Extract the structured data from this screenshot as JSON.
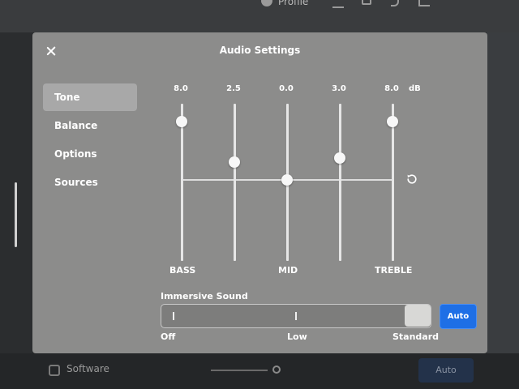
{
  "background": {
    "top_bar": {
      "profile_label": "Profile"
    },
    "bottom_bar": {
      "software_label": "Software",
      "auto_label": "Auto"
    }
  },
  "modal": {
    "title": "Audio Settings",
    "close_icon": "close-icon"
  },
  "sidebar": {
    "items": [
      {
        "label": "Tone",
        "active": true
      },
      {
        "label": "Balance",
        "active": false
      },
      {
        "label": "Options",
        "active": false
      },
      {
        "label": "Sources",
        "active": false
      }
    ]
  },
  "equalizer": {
    "unit": "dB",
    "min": -10,
    "max": 10,
    "bands": [
      {
        "value_label": "8.0",
        "value": 8.0
      },
      {
        "value_label": "2.5",
        "value": 2.5
      },
      {
        "value_label": "0.0",
        "value": 0.0
      },
      {
        "value_label": "3.0",
        "value": 3.0
      },
      {
        "value_label": "8.0",
        "value": 8.0
      }
    ],
    "band_labels": {
      "bass": "BASS",
      "mid": "MID",
      "treble": "TREBLE"
    },
    "reset_icon": "reset-icon"
  },
  "immersive_sound": {
    "label": "Immersive Sound",
    "options": [
      "Off",
      "Low",
      "Standard"
    ],
    "selected": "Standard",
    "auto_label": "Auto"
  },
  "colors": {
    "modal_bg": "#8c8c8b",
    "accent_blue": "#1e6fe6",
    "active_item_bg": "#a8a8a8"
  }
}
